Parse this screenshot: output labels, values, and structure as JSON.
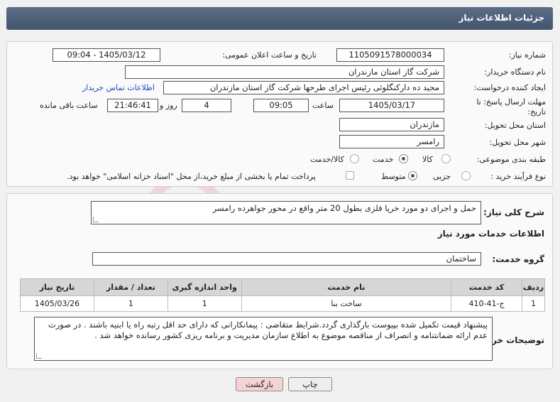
{
  "header": {
    "title": "جزئیات اطلاعات نیاز"
  },
  "form": {
    "need_number_label": "شماره نیاز:",
    "need_number": "1105091578000034",
    "announce_label": "تاریخ و ساعت اعلان عمومی:",
    "announce_value": "1405/03/12 - 09:04",
    "buyer_org_label": "نام دستگاه خریدار:",
    "buyer_org": "شرکت گاز استان مازندران",
    "creator_label": "ایجاد کننده درخواست:",
    "creator": "مجید ده دارکنگلوئی رئیس اجرای طرحها شرکت گاز استان مازندران",
    "buyer_contact_link": "اطلاعات تماس خریدار",
    "deadline_label": "مهلت ارسال پاسخ: تا تاریخ:",
    "deadline_date": "1405/03/17",
    "time_label": "ساعت",
    "deadline_time": "09:05",
    "days_value": "4",
    "days_label": "روز و",
    "remaining_time": "21:46:41",
    "remaining_label": "ساعت باقی مانده",
    "province_label": "استان محل تحویل:",
    "province": "مازندران",
    "city_label": "شهر محل تحویل:",
    "city": "رامسر",
    "category_label": "طبقه بندی موضوعی:",
    "category_options": [
      "کالا",
      "خدمت",
      "کالا/خدمت"
    ],
    "category_selected": "خدمت",
    "process_label": "نوع فرآیند خرید :",
    "process_options": [
      "جزیی",
      "متوسط"
    ],
    "process_selected": "متوسط",
    "payment_note": "پرداخت تمام یا بخشی از مبلغ خرید،از محل \"اسناد خزانه اسلامی\" خواهد بود."
  },
  "summary": {
    "label": "شرح کلی نیاز:",
    "text": "حمل و اجرای دو مورد خرپا فلزی بطول 20 متر واقع در محور جواهرده رامسر"
  },
  "services": {
    "section_title": "اطلاعات خدمات مورد نیاز",
    "group_label": "گروه خدمت:",
    "group_value": "ساختمان",
    "columns": [
      "ردیف",
      "کد خدمت",
      "نام خدمت",
      "واحد اندازه گیری",
      "تعداد / مقدار",
      "تاریخ نیاز"
    ],
    "rows": [
      [
        "1",
        "ج-41-410",
        "ساخت بنا",
        "1",
        "1",
        "1405/03/26"
      ]
    ]
  },
  "buyer_notes": {
    "label": "توضیحات خریدار:",
    "text": "پیشنهاد قیمت تکمیل شده بپیوست بارگذاری گردد.شرایط متقاضی : پیمانکارانی که دارای حد اقل رتبه راه یا ابنیه باشند . در صورت عدم ارائه ضمانتنامه و انصراف از مناقصه موضوع به اطلاع سازمان مدیریت و برنامه ریزی کشور رسانده خواهد شد ."
  },
  "buttons": {
    "print": "چاپ",
    "back": "بازگشت"
  },
  "colors": {
    "header": "#4f627a",
    "back_button": "#f6d3d3",
    "print_button": "#eeeeee",
    "link": "#1a4fbf"
  }
}
